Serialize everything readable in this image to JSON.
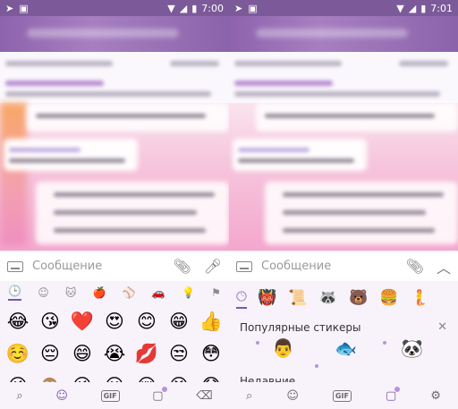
{
  "left": {
    "status": {
      "time": "7:00"
    },
    "input": {
      "placeholder": "Сообщение"
    },
    "categories": [
      "🕒",
      "☺",
      "🐱",
      "🍎",
      "⚾",
      "🚗",
      "💡",
      "⚑"
    ],
    "emoji_rows": [
      [
        "😂",
        "😘",
        "❤️",
        "😍",
        "😊",
        "😁",
        "👍"
      ],
      [
        "☺️",
        "😔",
        "😄",
        "😭",
        "💋",
        "😒",
        "😳"
      ],
      [
        "😜",
        "🙈",
        "😉",
        "😃",
        "😢",
        "😝",
        "😱"
      ]
    ],
    "bottom": {
      "gif": "GIF"
    }
  },
  "right": {
    "status": {
      "time": "7:01"
    },
    "input": {
      "placeholder": "Сообщение"
    },
    "sticker_tabs": [
      "👹",
      "📜",
      "🦝",
      "🐻",
      "🍔",
      "🧜"
    ],
    "popular_title": "Популярные стикеры",
    "popular_stickers": [
      "👨",
      "🐟",
      "🐼"
    ],
    "recent_title": "Недавние",
    "bottom": {
      "gif": "GIF"
    }
  },
  "colors": {
    "accent": "#7a55b0",
    "header": "#8d63ad",
    "panel": "#f8f3fb"
  }
}
